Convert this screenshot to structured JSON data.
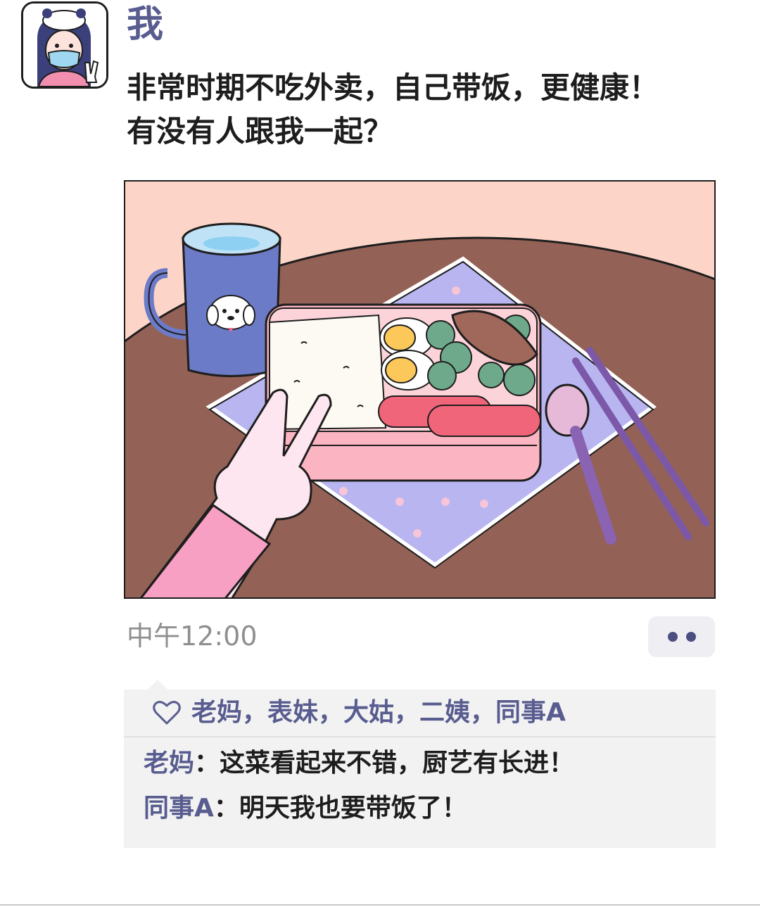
{
  "post": {
    "username": "我",
    "text": "非常时期不吃外卖，自己带饭，更健康！\n有没有人跟我一起？",
    "timestamp": "中午12:00",
    "image_alt": "",
    "avatar_icon": "user-avatar-icon"
  },
  "interactions": {
    "like_icon": "heart-outline-icon",
    "likes": "老妈，表妹，大姑，二姨，同事A",
    "more_icon": "more-dots-icon",
    "comments": [
      {
        "author": "老妈",
        "text": "：这菜看起来不错，厨艺有长进！"
      },
      {
        "author": "同事A",
        "text": "：明天我也要带饭了！"
      }
    ]
  },
  "colors": {
    "accent": "#585c8f",
    "text": "#1d1d1d",
    "muted": "#8f8f8f",
    "panel_bg": "#f2f2f2",
    "button_bg": "#eeeef3"
  }
}
